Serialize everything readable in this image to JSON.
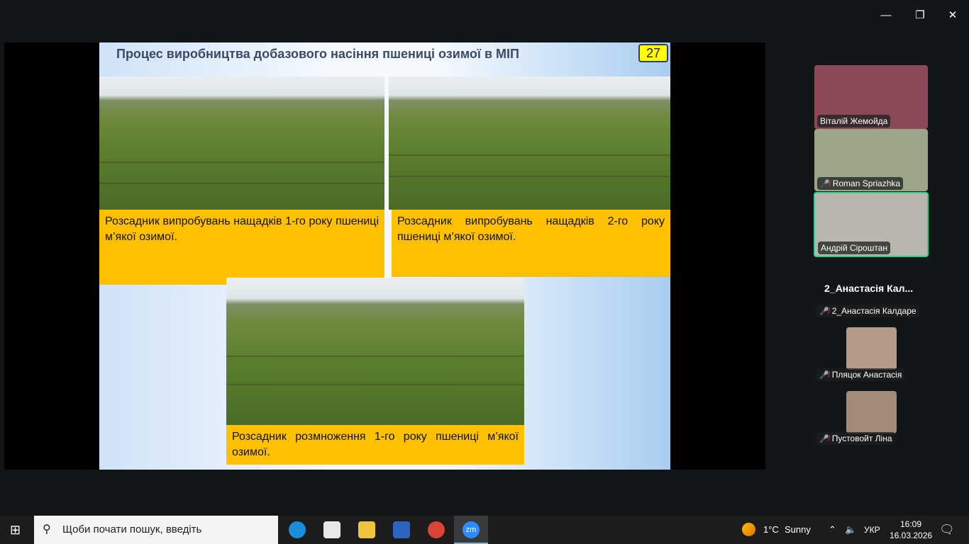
{
  "window": {
    "minimize": "—",
    "restore": "❐",
    "close": "✕"
  },
  "slide": {
    "title": "Процес виробництва добазового насіння пшениці озимої в МІП",
    "page_number": "27",
    "captions": [
      "Розсадник випробувань нащадків 1-го року пшениці м’якої озимої.",
      "Розсадник випробувань нащадків 2-го року пшениці м’якої озимої.",
      "Розсадник розмноження 1-го року пшениці м’якої озимої."
    ]
  },
  "participants": [
    {
      "name": "Віталій Жемойда",
      "muted": false
    },
    {
      "name": "Roman Spriazhka",
      "muted": true
    },
    {
      "name": "Андрій Сіроштан",
      "muted": false,
      "speaking": true
    }
  ],
  "section_title": "2_Анастасія Кал...",
  "small_participants": [
    {
      "name": "2_Анастасія Калдаре",
      "muted": true
    },
    {
      "name": "Пляцок Анастасія",
      "muted": true
    },
    {
      "name": "Пустовойт Ліна",
      "muted": true
    }
  ],
  "taskbar": {
    "search_placeholder": "Щоби почати пошук, введіть",
    "weather_temp": "1°C",
    "weather_text": "Sunny",
    "language": "УКР",
    "time": "16:09",
    "date": "16.03.2026",
    "zoom_label": "zm"
  },
  "colors": {
    "caption": "#ffc000",
    "speaker_border": "#23d886",
    "mute": "#e8424a"
  }
}
